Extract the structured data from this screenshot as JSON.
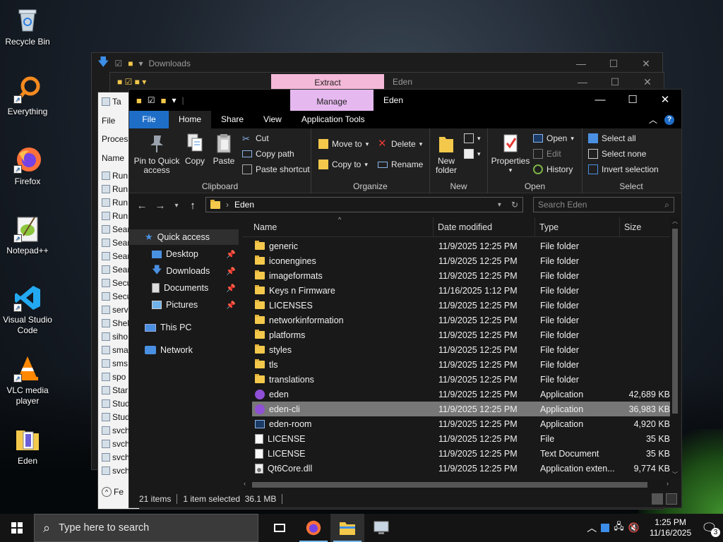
{
  "desktop": {
    "icons": [
      {
        "label": "Recycle Bin"
      },
      {
        "label": "Everything"
      },
      {
        "label": "Firefox"
      },
      {
        "label": "Notepad++"
      },
      {
        "label": "Visual Studio Code"
      },
      {
        "label": "VLC media player"
      },
      {
        "label": "Eden"
      }
    ]
  },
  "back_windows": {
    "downloads_title": "Downloads",
    "eden_title": "Eden",
    "extract_tab": "Extract",
    "task_manager": {
      "menu": [
        "Ta",
        "File",
        "Proces",
        "Name"
      ],
      "rows": [
        "Run",
        "Run",
        "Run",
        "Run",
        "Sear",
        "Sear",
        "Sear",
        "Sear",
        "Secu",
        "Secu",
        "serv",
        "Shel",
        "siho",
        "sma",
        "sms",
        "spo",
        "Star",
        "Stud",
        "Stud",
        "svch",
        "svch",
        "svch",
        "svch"
      ],
      "footer": "Fe"
    }
  },
  "window": {
    "title": "Eden",
    "manage_tab": "Manage",
    "tabs": [
      "File",
      "Home",
      "Share",
      "View",
      "Application Tools"
    ],
    "ribbon": {
      "clipboard": {
        "label": "Clipboard",
        "pin": "Pin to Quick access",
        "copy": "Copy",
        "paste": "Paste",
        "cut": "Cut",
        "copy_path": "Copy path",
        "paste_shortcut": "Paste shortcut"
      },
      "organize": {
        "label": "Organize",
        "move_to": "Move to",
        "copy_to": "Copy to",
        "delete": "Delete",
        "rename": "Rename"
      },
      "new": {
        "label": "New",
        "new_folder": "New folder"
      },
      "open": {
        "label": "Open",
        "properties": "Properties",
        "open": "Open",
        "edit": "Edit",
        "history": "History"
      },
      "select": {
        "label": "Select",
        "select_all": "Select all",
        "select_none": "Select none",
        "invert": "Invert selection"
      }
    },
    "address": {
      "path": "Eden",
      "search_placeholder": "Search Eden"
    },
    "nav": {
      "quick_access": "Quick access",
      "items": [
        "Desktop",
        "Downloads",
        "Documents",
        "Pictures"
      ],
      "this_pc": "This PC",
      "network": "Network"
    },
    "columns": {
      "name": "Name",
      "date": "Date modified",
      "type": "Type",
      "size": "Size"
    },
    "files": [
      {
        "name": "generic",
        "date": "11/9/2025 12:25 PM",
        "type": "File folder",
        "size": "",
        "icon": "folder"
      },
      {
        "name": "iconengines",
        "date": "11/9/2025 12:25 PM",
        "type": "File folder",
        "size": "",
        "icon": "folder"
      },
      {
        "name": "imageformats",
        "date": "11/9/2025 12:25 PM",
        "type": "File folder",
        "size": "",
        "icon": "folder"
      },
      {
        "name": "Keys n Firmware",
        "date": "11/16/2025 1:12 PM",
        "type": "File folder",
        "size": "",
        "icon": "folder"
      },
      {
        "name": "LICENSES",
        "date": "11/9/2025 12:25 PM",
        "type": "File folder",
        "size": "",
        "icon": "folder"
      },
      {
        "name": "networkinformation",
        "date": "11/9/2025 12:25 PM",
        "type": "File folder",
        "size": "",
        "icon": "folder"
      },
      {
        "name": "platforms",
        "date": "11/9/2025 12:25 PM",
        "type": "File folder",
        "size": "",
        "icon": "folder"
      },
      {
        "name": "styles",
        "date": "11/9/2025 12:25 PM",
        "type": "File folder",
        "size": "",
        "icon": "folder"
      },
      {
        "name": "tls",
        "date": "11/9/2025 12:25 PM",
        "type": "File folder",
        "size": "",
        "icon": "folder"
      },
      {
        "name": "translations",
        "date": "11/9/2025 12:25 PM",
        "type": "File folder",
        "size": "",
        "icon": "folder"
      },
      {
        "name": "eden",
        "date": "11/9/2025 12:25 PM",
        "type": "Application",
        "size": "42,689 KB",
        "icon": "app"
      },
      {
        "name": "eden-cli",
        "date": "11/9/2025 12:25 PM",
        "type": "Application",
        "size": "36,983 KB",
        "icon": "app",
        "selected": true
      },
      {
        "name": "eden-room",
        "date": "11/9/2025 12:25 PM",
        "type": "Application",
        "size": "4,920 KB",
        "icon": "window"
      },
      {
        "name": "LICENSE",
        "date": "11/9/2025 12:25 PM",
        "type": "File",
        "size": "35 KB",
        "icon": "doc"
      },
      {
        "name": "LICENSE",
        "date": "11/9/2025 12:25 PM",
        "type": "Text Document",
        "size": "35 KB",
        "icon": "doc"
      },
      {
        "name": "Qt6Core.dll",
        "date": "11/9/2025 12:25 PM",
        "type": "Application exten...",
        "size": "9,774 KB",
        "icon": "dll"
      }
    ],
    "status": {
      "items": "21 items",
      "selected": "1 item selected  36.1 MB"
    }
  },
  "taskbar": {
    "search_placeholder": "Type here to search",
    "time": "1:25 PM",
    "date": "11/16/2025",
    "notifications": "3"
  }
}
